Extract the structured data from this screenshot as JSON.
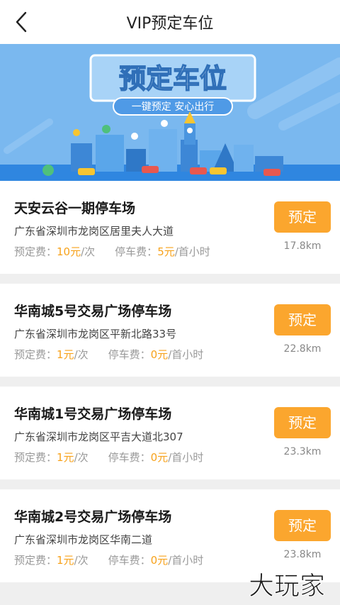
{
  "header": {
    "title": "VIP预定车位",
    "back_icon": "chevron-left-icon"
  },
  "banner": {
    "headline": "预定车位",
    "tagline": "一键预定  安心出行",
    "colors": {
      "sky": "#7ab8ef",
      "panel": "#9ecdf5",
      "accent": "#2f86e0"
    }
  },
  "parkings": [
    {
      "name": "天安云谷一期停车场",
      "address": "广东省深圳市龙岗区居里夫人大道",
      "booking_label": "预定费：",
      "booking_value": "10元",
      "booking_unit": "/次",
      "parking_label": "停车费：",
      "parking_value": "5元",
      "parking_unit": "/首小时",
      "button": "预定",
      "distance": "17.8km"
    },
    {
      "name": "华南城5号交易广场停车场",
      "address": "广东省深圳市龙岗区平新北路33号",
      "booking_label": "预定费：",
      "booking_value": "1元",
      "booking_unit": "/次",
      "parking_label": "停车费：",
      "parking_value": "0元",
      "parking_unit": "/首小时",
      "button": "预定",
      "distance": "22.8km"
    },
    {
      "name": "华南城1号交易广场停车场",
      "address": "广东省深圳市龙岗区平吉大道北307",
      "booking_label": "预定费：",
      "booking_value": "1元",
      "booking_unit": "/次",
      "parking_label": "停车费：",
      "parking_value": "0元",
      "parking_unit": "/首小时",
      "button": "预定",
      "distance": "23.3km"
    },
    {
      "name": "华南城2号交易广场停车场",
      "address": "广东省深圳市龙岗区华南二道",
      "booking_label": "预定费：",
      "booking_value": "1元",
      "booking_unit": "/次",
      "parking_label": "停车费：",
      "parking_value": "0元",
      "parking_unit": "/首小时",
      "button": "预定",
      "distance": "23.8km"
    }
  ],
  "watermark": "大玩家",
  "colors": {
    "button": "#fba62e",
    "price": "#f7a21b",
    "background": "#efefef"
  }
}
